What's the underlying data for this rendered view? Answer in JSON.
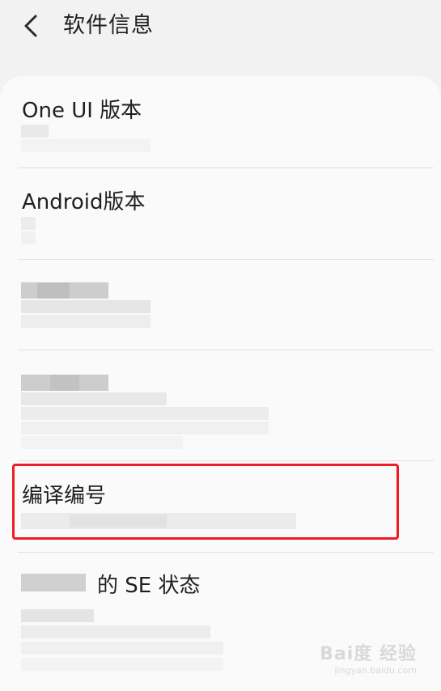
{
  "header": {
    "title": "软件信息"
  },
  "items": [
    {
      "label": "One UI 版本"
    },
    {
      "label": "Android版本"
    },
    {
      "label": ""
    },
    {
      "label": ""
    },
    {
      "label": "编译编号"
    },
    {
      "label": "的 SE 状态"
    }
  ],
  "watermark": {
    "logo": "Bai度 经验",
    "url": "jingyan.baidu.com"
  },
  "colors": {
    "highlight": "#ee1c25",
    "background": "#f2f2f2",
    "card": "#fafafa"
  }
}
